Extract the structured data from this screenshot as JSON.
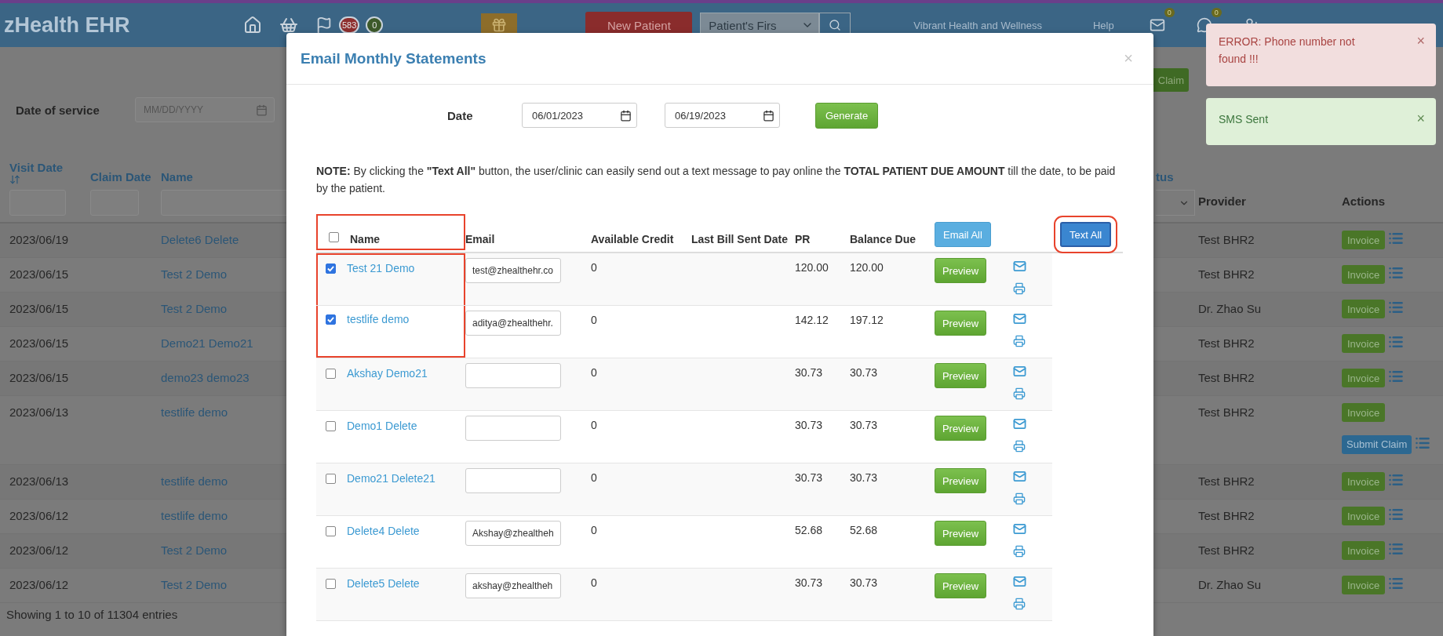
{
  "header": {
    "brand": "zHealth EHR",
    "badges": [
      {
        "count": "583",
        "color": "#8e2f2f"
      },
      {
        "count": "0",
        "color": "#3d5a2a"
      }
    ],
    "new_patient_button": "New Patient",
    "patient_search": {
      "value": "Patient's Firs"
    },
    "practice_link": "Vibrant Health and Wellness",
    "help_link": "Help",
    "message_count": "0",
    "chat_count": "0"
  },
  "filters": {
    "date_of_service_label": "Date of service",
    "date_placeholder": "MM/DD/YYYY"
  },
  "background_button": "Claim",
  "claims_table": {
    "columns": [
      "Visit Date",
      "Claim Date",
      "Name"
    ],
    "status_fragment": "tus",
    "right_columns": [
      "Provider",
      "Actions"
    ],
    "rows": [
      {
        "visit_date": "2023/06/19",
        "name": "Delete6 Delete",
        "provider": "Test BHR2",
        "actions": [
          "Invoice"
        ]
      },
      {
        "visit_date": "2023/06/15",
        "name": "Test 2 Demo",
        "provider": "Test BHR2",
        "actions": [
          "Invoice"
        ]
      },
      {
        "visit_date": "2023/06/15",
        "name": "Test 2 Demo",
        "provider": "Dr. Zhao Su",
        "actions": [
          "Invoice"
        ]
      },
      {
        "visit_date": "2023/06/15",
        "name": "Demo21 Demo21",
        "provider": "Test BHR2",
        "actions": [
          "Invoice"
        ]
      },
      {
        "visit_date": "2023/06/15",
        "name": "demo23 demo23",
        "provider": "Test BHR2",
        "actions": [
          "Invoice"
        ]
      },
      {
        "visit_date": "2023/06/13",
        "name": "testlife demo",
        "provider": "Test BHR2",
        "actions": [
          "Invoice",
          "Submit Claim"
        ]
      },
      {
        "visit_date": "2023/06/13",
        "name": "testlife demo",
        "provider": "Test BHR2",
        "actions": [
          "Invoice"
        ]
      },
      {
        "visit_date": "2023/06/12",
        "name": "testlife demo",
        "provider": "Test BHR2",
        "actions": [
          "Invoice"
        ]
      },
      {
        "visit_date": "2023/06/12",
        "name": "Test 2 Demo",
        "provider": "Test BHR2",
        "actions": [
          "Invoice"
        ]
      },
      {
        "visit_date": "2023/06/12",
        "name": "Test 2 Demo",
        "provider": "Dr. Zhao Su",
        "actions": [
          "Invoice"
        ]
      }
    ],
    "footer": "Showing 1 to 10 of 11304 entries"
  },
  "modal": {
    "title": "Email Monthly Statements",
    "close": "×",
    "date_label": "Date",
    "date_from": "06/01/2023",
    "date_to": "06/19/2023",
    "generate_button": "Generate",
    "note": "**NOTE:** By clicking the **\"Text All\"** button, the user/clinic can easily send out a text message to pay online the **TOTAL PATIENT DUE AMOUNT** till the date, to be paid by the patient.",
    "select_all": {
      "checked": false,
      "highlighted": true
    },
    "columns": [
      "Name",
      "Email",
      "Available Credit",
      "Last Bill Sent Date",
      "PR",
      "Balance Due"
    ],
    "email_all_button": "Email All",
    "text_all_button": {
      "label": "Text All",
      "highlighted": true
    },
    "rows": [
      {
        "checked": true,
        "highlighted": true,
        "name": "Test 21 Demo",
        "email": "test@zhealthehr.co",
        "available_credit": "0",
        "pr": "120.00",
        "balance_due": "120.00",
        "preview_button": "Preview"
      },
      {
        "checked": true,
        "highlighted": true,
        "name": "testlife demo",
        "email": "aditya@zhealthehr.",
        "available_credit": "0",
        "pr": "142.12",
        "balance_due": "197.12",
        "preview_button": "Preview"
      },
      {
        "checked": false,
        "highlighted": false,
        "name": "Akshay Demo21",
        "available_credit": "0",
        "pr": "30.73",
        "balance_due": "30.73",
        "preview_button": "Preview"
      },
      {
        "checked": false,
        "highlighted": false,
        "name": "Demo1 Delete",
        "available_credit": "0",
        "pr": "30.73",
        "balance_due": "30.73",
        "preview_button": "Preview"
      },
      {
        "checked": false,
        "highlighted": false,
        "name": "Demo21 Delete21",
        "available_credit": "0",
        "pr": "30.73",
        "balance_due": "30.73",
        "preview_button": "Preview"
      },
      {
        "checked": false,
        "highlighted": false,
        "name": "Delete4 Delete",
        "email": "Akshay@zhealtheh",
        "available_credit": "0",
        "pr": "52.68",
        "balance_due": "52.68",
        "preview_button": "Preview"
      },
      {
        "checked": false,
        "highlighted": false,
        "name": "Delete5 Delete",
        "email": "akshay@zhealtheh",
        "available_credit": "0",
        "pr": "30.73",
        "balance_due": "30.73",
        "preview_button": "Preview"
      }
    ]
  },
  "toasts": [
    {
      "kind": "error",
      "message": "ERROR: Phone number not found !!!",
      "close": "×"
    },
    {
      "kind": "success",
      "message": "SMS Sent",
      "close": "×"
    }
  ]
}
